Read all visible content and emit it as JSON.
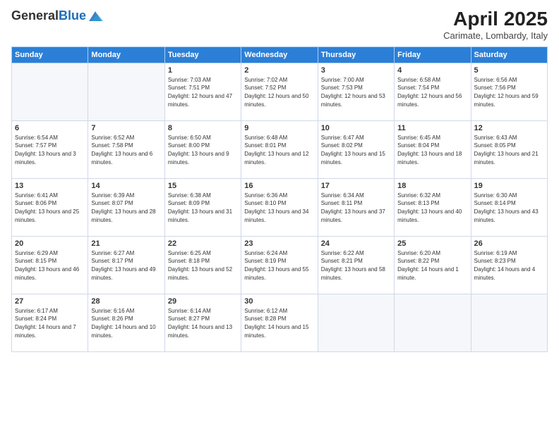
{
  "header": {
    "logo_general": "General",
    "logo_blue": "Blue",
    "title": "April 2025",
    "subtitle": "Carimate, Lombardy, Italy"
  },
  "weekdays": [
    "Sunday",
    "Monday",
    "Tuesday",
    "Wednesday",
    "Thursday",
    "Friday",
    "Saturday"
  ],
  "weeks": [
    [
      {
        "day": "",
        "sunrise": "",
        "sunset": "",
        "daylight": ""
      },
      {
        "day": "",
        "sunrise": "",
        "sunset": "",
        "daylight": ""
      },
      {
        "day": "1",
        "sunrise": "Sunrise: 7:03 AM",
        "sunset": "Sunset: 7:51 PM",
        "daylight": "Daylight: 12 hours and 47 minutes."
      },
      {
        "day": "2",
        "sunrise": "Sunrise: 7:02 AM",
        "sunset": "Sunset: 7:52 PM",
        "daylight": "Daylight: 12 hours and 50 minutes."
      },
      {
        "day": "3",
        "sunrise": "Sunrise: 7:00 AM",
        "sunset": "Sunset: 7:53 PM",
        "daylight": "Daylight: 12 hours and 53 minutes."
      },
      {
        "day": "4",
        "sunrise": "Sunrise: 6:58 AM",
        "sunset": "Sunset: 7:54 PM",
        "daylight": "Daylight: 12 hours and 56 minutes."
      },
      {
        "day": "5",
        "sunrise": "Sunrise: 6:56 AM",
        "sunset": "Sunset: 7:56 PM",
        "daylight": "Daylight: 12 hours and 59 minutes."
      }
    ],
    [
      {
        "day": "6",
        "sunrise": "Sunrise: 6:54 AM",
        "sunset": "Sunset: 7:57 PM",
        "daylight": "Daylight: 13 hours and 3 minutes."
      },
      {
        "day": "7",
        "sunrise": "Sunrise: 6:52 AM",
        "sunset": "Sunset: 7:58 PM",
        "daylight": "Daylight: 13 hours and 6 minutes."
      },
      {
        "day": "8",
        "sunrise": "Sunrise: 6:50 AM",
        "sunset": "Sunset: 8:00 PM",
        "daylight": "Daylight: 13 hours and 9 minutes."
      },
      {
        "day": "9",
        "sunrise": "Sunrise: 6:48 AM",
        "sunset": "Sunset: 8:01 PM",
        "daylight": "Daylight: 13 hours and 12 minutes."
      },
      {
        "day": "10",
        "sunrise": "Sunrise: 6:47 AM",
        "sunset": "Sunset: 8:02 PM",
        "daylight": "Daylight: 13 hours and 15 minutes."
      },
      {
        "day": "11",
        "sunrise": "Sunrise: 6:45 AM",
        "sunset": "Sunset: 8:04 PM",
        "daylight": "Daylight: 13 hours and 18 minutes."
      },
      {
        "day": "12",
        "sunrise": "Sunrise: 6:43 AM",
        "sunset": "Sunset: 8:05 PM",
        "daylight": "Daylight: 13 hours and 21 minutes."
      }
    ],
    [
      {
        "day": "13",
        "sunrise": "Sunrise: 6:41 AM",
        "sunset": "Sunset: 8:06 PM",
        "daylight": "Daylight: 13 hours and 25 minutes."
      },
      {
        "day": "14",
        "sunrise": "Sunrise: 6:39 AM",
        "sunset": "Sunset: 8:07 PM",
        "daylight": "Daylight: 13 hours and 28 minutes."
      },
      {
        "day": "15",
        "sunrise": "Sunrise: 6:38 AM",
        "sunset": "Sunset: 8:09 PM",
        "daylight": "Daylight: 13 hours and 31 minutes."
      },
      {
        "day": "16",
        "sunrise": "Sunrise: 6:36 AM",
        "sunset": "Sunset: 8:10 PM",
        "daylight": "Daylight: 13 hours and 34 minutes."
      },
      {
        "day": "17",
        "sunrise": "Sunrise: 6:34 AM",
        "sunset": "Sunset: 8:11 PM",
        "daylight": "Daylight: 13 hours and 37 minutes."
      },
      {
        "day": "18",
        "sunrise": "Sunrise: 6:32 AM",
        "sunset": "Sunset: 8:13 PM",
        "daylight": "Daylight: 13 hours and 40 minutes."
      },
      {
        "day": "19",
        "sunrise": "Sunrise: 6:30 AM",
        "sunset": "Sunset: 8:14 PM",
        "daylight": "Daylight: 13 hours and 43 minutes."
      }
    ],
    [
      {
        "day": "20",
        "sunrise": "Sunrise: 6:29 AM",
        "sunset": "Sunset: 8:15 PM",
        "daylight": "Daylight: 13 hours and 46 minutes."
      },
      {
        "day": "21",
        "sunrise": "Sunrise: 6:27 AM",
        "sunset": "Sunset: 8:17 PM",
        "daylight": "Daylight: 13 hours and 49 minutes."
      },
      {
        "day": "22",
        "sunrise": "Sunrise: 6:25 AM",
        "sunset": "Sunset: 8:18 PM",
        "daylight": "Daylight: 13 hours and 52 minutes."
      },
      {
        "day": "23",
        "sunrise": "Sunrise: 6:24 AM",
        "sunset": "Sunset: 8:19 PM",
        "daylight": "Daylight: 13 hours and 55 minutes."
      },
      {
        "day": "24",
        "sunrise": "Sunrise: 6:22 AM",
        "sunset": "Sunset: 8:21 PM",
        "daylight": "Daylight: 13 hours and 58 minutes."
      },
      {
        "day": "25",
        "sunrise": "Sunrise: 6:20 AM",
        "sunset": "Sunset: 8:22 PM",
        "daylight": "Daylight: 14 hours and 1 minute."
      },
      {
        "day": "26",
        "sunrise": "Sunrise: 6:19 AM",
        "sunset": "Sunset: 8:23 PM",
        "daylight": "Daylight: 14 hours and 4 minutes."
      }
    ],
    [
      {
        "day": "27",
        "sunrise": "Sunrise: 6:17 AM",
        "sunset": "Sunset: 8:24 PM",
        "daylight": "Daylight: 14 hours and 7 minutes."
      },
      {
        "day": "28",
        "sunrise": "Sunrise: 6:16 AM",
        "sunset": "Sunset: 8:26 PM",
        "daylight": "Daylight: 14 hours and 10 minutes."
      },
      {
        "day": "29",
        "sunrise": "Sunrise: 6:14 AM",
        "sunset": "Sunset: 8:27 PM",
        "daylight": "Daylight: 14 hours and 13 minutes."
      },
      {
        "day": "30",
        "sunrise": "Sunrise: 6:12 AM",
        "sunset": "Sunset: 8:28 PM",
        "daylight": "Daylight: 14 hours and 15 minutes."
      },
      {
        "day": "",
        "sunrise": "",
        "sunset": "",
        "daylight": ""
      },
      {
        "day": "",
        "sunrise": "",
        "sunset": "",
        "daylight": ""
      },
      {
        "day": "",
        "sunrise": "",
        "sunset": "",
        "daylight": ""
      }
    ]
  ]
}
